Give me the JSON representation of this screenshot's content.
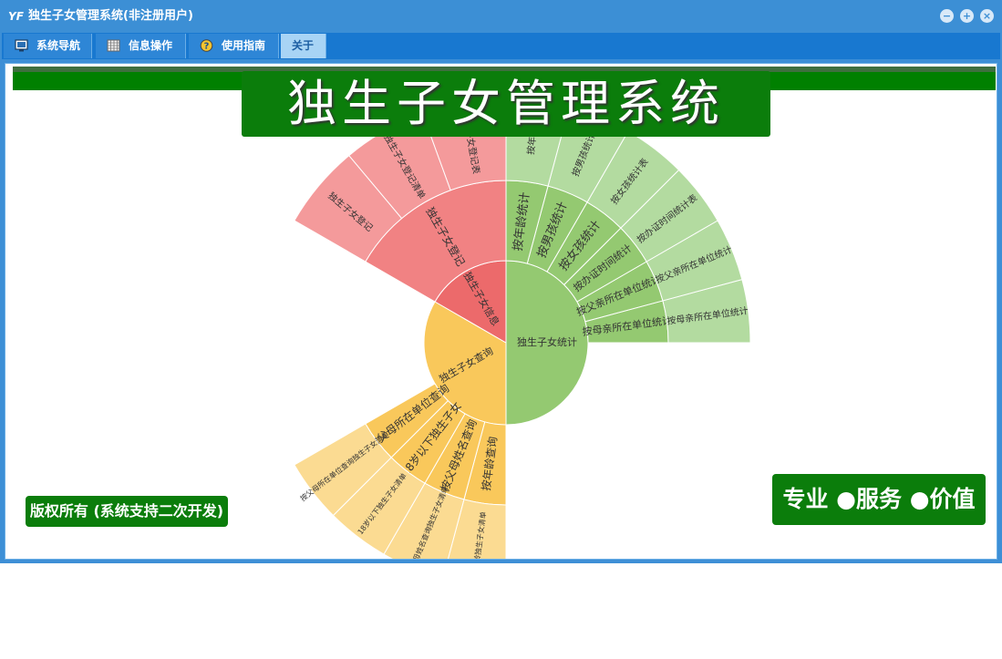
{
  "window": {
    "title": "独生子女管理系统(非注册用户)"
  },
  "menu": {
    "tabs": [
      {
        "label": "系统导航"
      },
      {
        "label": "信息操作"
      },
      {
        "label": "使用指南"
      },
      {
        "label": "关于"
      }
    ]
  },
  "banner": {
    "title": "独生子女管理系统"
  },
  "footer": {
    "copyright": "版权所有 (系统支持二次开发)",
    "slogan": "专业 ●服务 ●价值"
  },
  "sunburst": {
    "colors": {
      "stat": "#94c971",
      "stat_light": "#b3dba0",
      "query": "#f9c85b",
      "query_light": "#fbdb92",
      "info": "#ec6a6b",
      "info_mid": "#f18283",
      "info_light": "#f49a9b"
    },
    "inner": [
      {
        "label": "独生子女统计"
      },
      {
        "label": "独生子女查询"
      },
      {
        "label": "独生子女信息"
      }
    ],
    "stat_level2": [
      "按母亲所在单位统计",
      "按父亲所在单位统计",
      "按办证时间统计",
      "按女孩统计",
      "按男孩统计",
      "按年龄统计"
    ],
    "stat_level3": [
      "按母亲所在单位统计",
      "按父亲所在单位统计",
      "按办证时间统计表",
      "按女孩统计表",
      "按男孩统计",
      "按年龄"
    ],
    "query_level2": [
      "按年龄查询",
      "按父母姓名查询",
      "18岁以下独生子女",
      "按父母所在单位查询"
    ],
    "query_level3": [
      "按年龄独生子女清单",
      "按父母姓名查询独生子女清单",
      "18岁以下独生子女清单",
      "按父母所在单位查询独生子女清单"
    ],
    "info_level2": [
      "独生子女登记"
    ],
    "info_level3": [
      "独生子女登记表",
      "独生子女登记清单",
      "独生子女登记"
    ]
  }
}
